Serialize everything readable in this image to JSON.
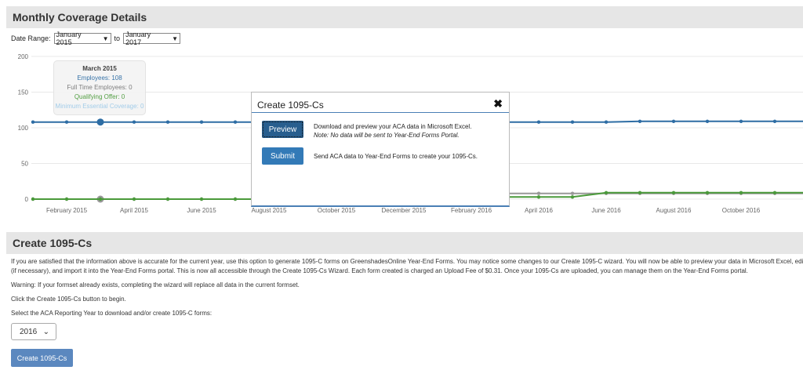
{
  "coverage": {
    "title": "Monthly Coverage Details",
    "date_range_label": "Date Range:",
    "from": "January 2015",
    "to_label": "to",
    "to": "January 2017"
  },
  "tooltip": {
    "title": "March 2015",
    "employees": "Employees: 108",
    "full_time": "Full Time Employees: 0",
    "qualifying": "Qualifying Offer: 0",
    "mec": "Minimum Essential Coverage: 0"
  },
  "chart_data": {
    "type": "line",
    "ylim": [
      0,
      200
    ],
    "y_ticks": [
      "200",
      "150",
      "100",
      "50",
      "0"
    ],
    "x_tick_labels": [
      "February 2015",
      "April 2015",
      "June 2015",
      "August 2015",
      "October 2015",
      "December 2015",
      "February 2016",
      "April 2016",
      "June 2016",
      "August 2016",
      "October 2016",
      "De"
    ],
    "x": [
      "2015-01",
      "2015-02",
      "2015-03",
      "2015-04",
      "2015-05",
      "2015-06",
      "2015-07",
      "2015-08",
      "2015-09",
      "2015-10",
      "2015-11",
      "2015-12",
      "2016-01",
      "2016-02",
      "2016-03",
      "2016-04",
      "2016-05",
      "2016-06",
      "2016-07",
      "2016-08",
      "2016-09",
      "2016-10",
      "2016-11",
      "2016-12",
      "2017-01"
    ],
    "series": [
      {
        "values": [
          108,
          108,
          108,
          108,
          108,
          108,
          108,
          108,
          108,
          108,
          108,
          108,
          108,
          108,
          108,
          108,
          108,
          108,
          109,
          109,
          109,
          109,
          109,
          109,
          109
        ],
        "color": "#2e6da4"
      },
      {
        "values": [
          0,
          0,
          0,
          0,
          0,
          0,
          0,
          0,
          0,
          0,
          0,
          0,
          0,
          0,
          8,
          8,
          8,
          8,
          8,
          8,
          8,
          8,
          8,
          8,
          8
        ],
        "color": "#999999"
      },
      {
        "values": [
          0,
          0,
          0,
          0,
          0,
          0,
          0,
          0,
          0,
          0,
          0,
          0,
          0,
          0,
          3,
          3,
          3,
          9,
          9,
          9,
          9,
          9,
          9,
          9,
          9
        ],
        "color": "#4a9a3a"
      }
    ]
  },
  "create": {
    "title": "Create 1095-Cs",
    "para1_line1": "If you are satisfied that the information above is accurate for the current year, use this option to generate 1095-C forms on GreenshadesOnline Year-End Forms. You may notice some changes to our Create 1095-C wizard. You will now be able to preview your data in Microsoft Excel, edit your",
    "para1_line2": "(if necessary), and import it into the Year-End Forms portal. This is now all accessible through the Create 1095-Cs Wizard. Each form created is charged an Upload Fee of $0.31. Once your 1095-Cs are uploaded, you can manage them on the Year-End Forms portal.",
    "warning": "Warning: If your formset already exists, completing the wizard will replace all data in the current formset.",
    "click_text": "Click the Create 1095-Cs button to begin.",
    "select_label": "Select the ACA Reporting Year to download and/or create 1095-C forms:",
    "year": "2016",
    "button": "Create 1095-Cs"
  },
  "modal": {
    "title": "Create 1095-Cs",
    "close": "✖",
    "preview_label": "Preview",
    "preview_text": "Download and preview your ACA data in Microsoft Excel.",
    "preview_note": "Note: No data will be sent to Year-End Forms Portal.",
    "submit_label": "Submit",
    "submit_text": "Send ACA data to Year-End Forms to create your 1095-Cs."
  }
}
